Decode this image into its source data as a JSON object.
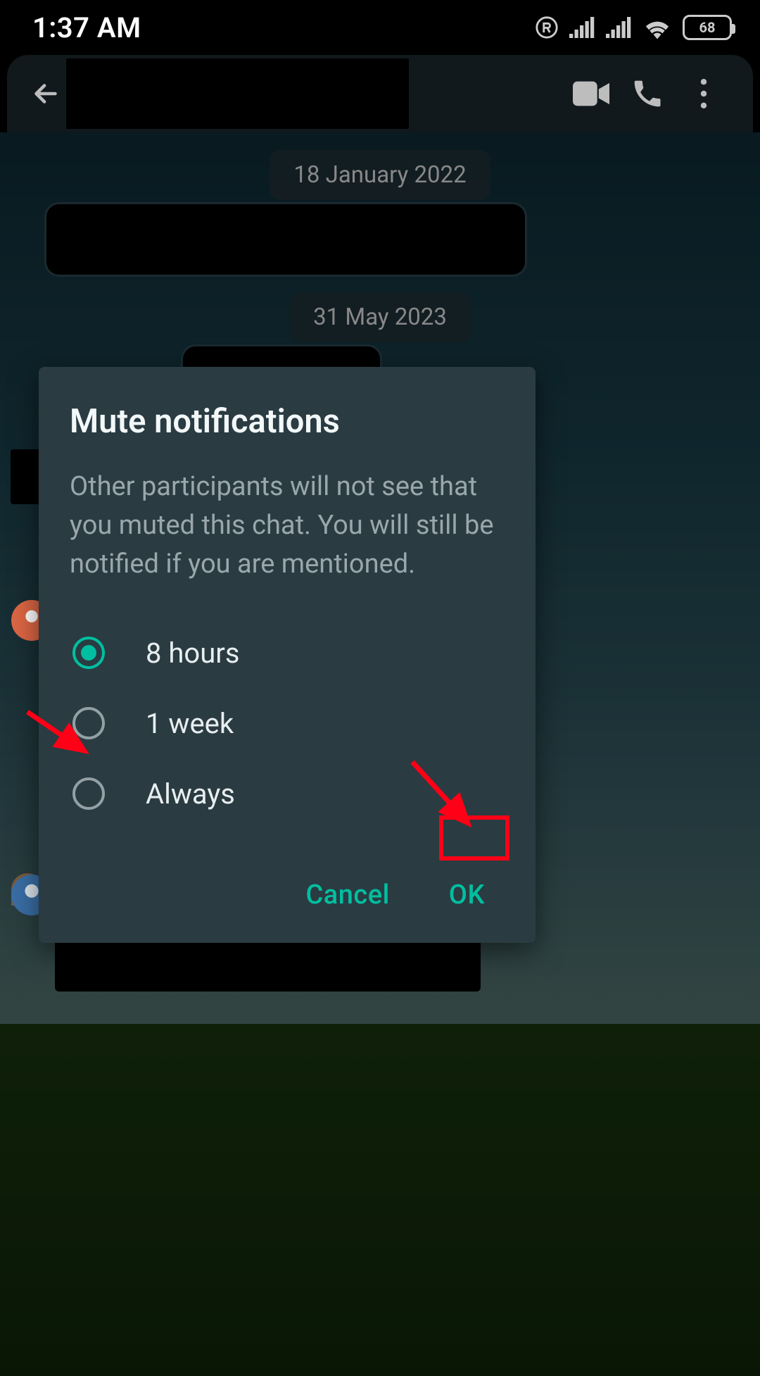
{
  "status": {
    "time": "1:37 AM",
    "battery": "68"
  },
  "chat": {
    "date1": "18 January 2022",
    "date2": "31 May 2023"
  },
  "dialog": {
    "title": "Mute notifications",
    "body": "Other participants will not see that you muted this chat. You will still be notified if you are mentioned.",
    "options": [
      {
        "label": "8 hours",
        "selected": true
      },
      {
        "label": "1 week",
        "selected": false
      },
      {
        "label": "Always",
        "selected": false
      }
    ],
    "cancel": "Cancel",
    "ok": "OK"
  }
}
